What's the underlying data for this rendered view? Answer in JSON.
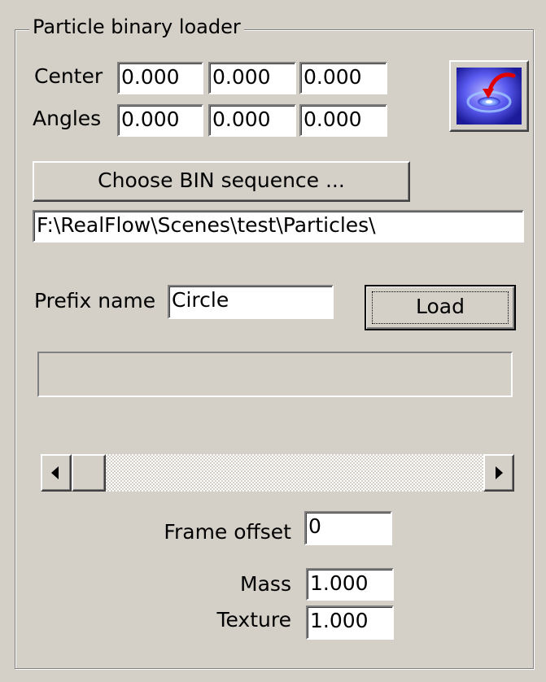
{
  "group": {
    "title": "Particle binary loader"
  },
  "center": {
    "label": "Center",
    "x": "0.000",
    "y": "0.000",
    "z": "0.000"
  },
  "angles": {
    "label": "Angles",
    "x": "0.000",
    "y": "0.000",
    "z": "0.000"
  },
  "reset_button": {
    "icon": "reset-icon",
    "colors": {
      "disc_light": "#8a8aff",
      "disc_dark": "#2a2ab0",
      "arrow": "#e00000"
    }
  },
  "choose_button": {
    "label": "Choose BIN sequence ..."
  },
  "path": {
    "value": "F:\\RealFlow\\Scenes\\test\\Particles\\"
  },
  "prefix": {
    "label": "Prefix name",
    "value": "Circle"
  },
  "load_button": {
    "label": "Load"
  },
  "progress": {
    "fraction": 0
  },
  "scrollbar": {
    "left_icon": "arrow-left-icon",
    "right_icon": "arrow-right-icon",
    "position": 0
  },
  "frame_offset": {
    "label": "Frame offset",
    "value": "0"
  },
  "mass": {
    "label": "Mass",
    "value": "1.000"
  },
  "texture": {
    "label": "Texture",
    "value": "1.000"
  },
  "colors": {
    "face": "#d4d0c8",
    "field": "#ffffff",
    "shadow": "#808080",
    "highlight": "#ffffff"
  }
}
